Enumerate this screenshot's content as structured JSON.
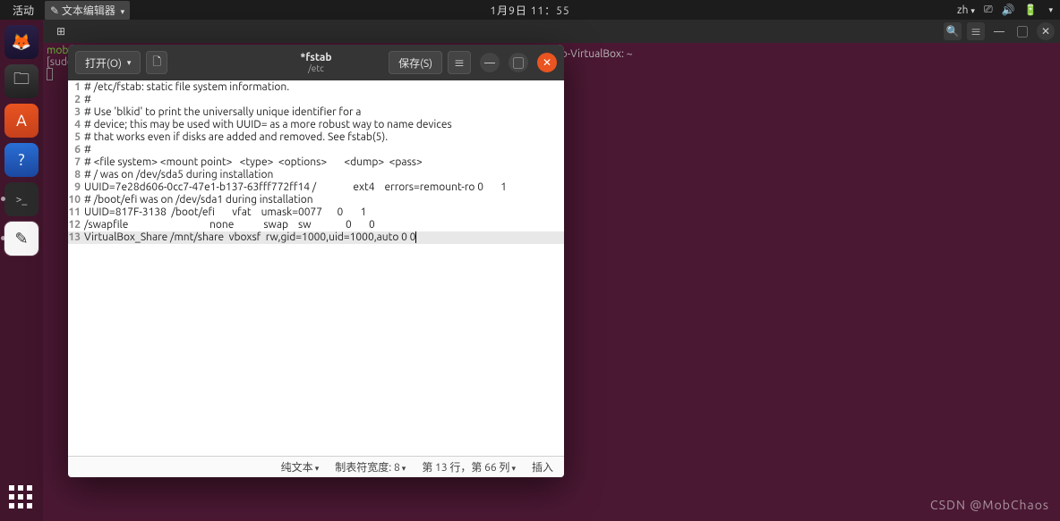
{
  "top_panel": {
    "activities": "活动",
    "app_menu_icon": "edit-icon",
    "app_menu_label": "文本编辑器",
    "clock": "1月9日 11：55",
    "input_label": "zh",
    "tray_icons": [
      "network-icon",
      "volume-icon",
      "battery-icon",
      "power-icon"
    ]
  },
  "dock": {
    "apps": [
      {
        "name": "firefox",
        "glyph": "🦊"
      },
      {
        "name": "files",
        "glyph": "📁"
      },
      {
        "name": "software",
        "glyph": "A"
      },
      {
        "name": "help",
        "glyph": "?"
      },
      {
        "name": "terminal",
        "glyph": ""
      },
      {
        "name": "text-editor",
        "glyph": "✎",
        "running": true,
        "active": true
      }
    ],
    "show_apps": "apps-grid-icon"
  },
  "bg_terminal": {
    "title": "mob@mob-VirtualBox: ~",
    "prompt_user": "mob@mo",
    "prompt_line2_prefix": "[sudo",
    "buttons": {
      "search": "🔍",
      "menu": "≡",
      "min": "—",
      "max": "▢",
      "close": "✕"
    }
  },
  "gedit": {
    "open_label": "打开(O)",
    "new_tab_tooltip": "新建",
    "title": "*fstab",
    "subtitle": "/etc",
    "save_label": "保存(S)",
    "hamburger": "≡",
    "window_buttons": {
      "min": "—",
      "max": "▢",
      "close": "✕"
    },
    "file_lines": [
      "# /etc/fstab: static file system information.",
      "#",
      "# Use 'blkid' to print the universally unique identifier for a",
      "# device; this may be used with UUID= as a more robust way to name devices",
      "# that works even if disks are added and removed. See fstab(5).",
      "#",
      "# <file system> <mount point>   <type>  <options>       <dump>  <pass>",
      "# / was on /dev/sda5 during installation",
      "UUID=7e28d606-0cc7-47e1-b137-63fff772ff14 /               ext4    errors=remount-ro 0       1",
      "# /boot/efi was on /dev/sda1 during installation",
      "UUID=817F-3138  /boot/efi       vfat    umask=0077      0       1",
      "/swapfile                                 none            swap    sw              0       0",
      "VirtualBox_Share /mnt/share  vboxsf  rw,gid=1000,uid=1000,auto 0 0"
    ],
    "cursor_line": 13,
    "statusbar": {
      "syntax": "纯文本",
      "tab_width": "制表符宽度: 8",
      "position": "第 13 行，第 66 列",
      "mode": "插入"
    }
  },
  "watermark": "CSDN @MobChaos"
}
